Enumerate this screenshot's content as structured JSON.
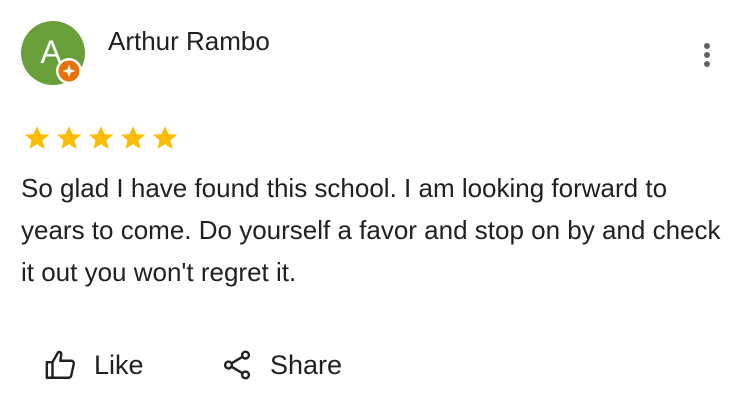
{
  "reviewer": {
    "initial": "A",
    "name": "Arthur Rambo",
    "avatar_color": "#689f38",
    "badge": "local-guide-icon"
  },
  "rating": {
    "stars": 5,
    "max": 5,
    "star_color": "#fbbc04"
  },
  "review": {
    "text": "So glad I have found this school. I am looking forward to years to come. Do yourself a favor and stop on by and check it out you won't regret it."
  },
  "actions": {
    "like_label": "Like",
    "share_label": "Share"
  },
  "icons": {
    "more": "more-vert-icon",
    "like": "thumb-up-icon",
    "share": "share-icon"
  }
}
